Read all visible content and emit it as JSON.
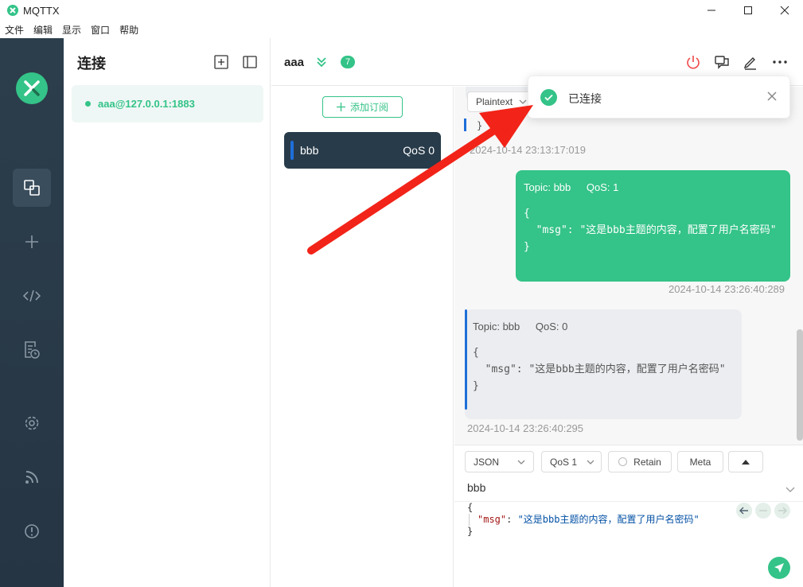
{
  "window": {
    "title": "MQTTX"
  },
  "menu": {
    "items": [
      "文件",
      "编辑",
      "显示",
      "窗口",
      "帮助"
    ]
  },
  "connections": {
    "title": "连接",
    "items": [
      {
        "name": "aaa@127.0.0.1:1883",
        "status": "connected"
      }
    ]
  },
  "header": {
    "name": "aaa",
    "unread_count": "7"
  },
  "subscriptions": {
    "add_label": "添加订阅",
    "items": [
      {
        "topic": "bbb",
        "qos": "QoS 0"
      }
    ]
  },
  "messages": {
    "format": "Plaintext",
    "prev_brace": "}",
    "prev_time": "2024-10-14 23:13:17:019",
    "list": [
      {
        "direction": "out",
        "topic": "Topic: bbb",
        "qos": "QoS: 1",
        "body": "{\n  \"msg\": \"这是bbb主题的内容，配置了用户名密码\"\n}",
        "time": "2024-10-14 23:26:40:289"
      },
      {
        "direction": "in",
        "topic": "Topic: bbb",
        "qos": "QoS: 0",
        "body": "{\n  \"msg\": \"这是bbb主题的内容，配置了用户名密码\"\n}",
        "time": "2024-10-14 23:26:40:295"
      }
    ]
  },
  "compose": {
    "format": "JSON",
    "qos": "QoS 1",
    "retain_label": "Retain",
    "meta_label": "Meta",
    "topic": "bbb",
    "body_open": "{",
    "body_key": "\"msg\"",
    "body_sep": ": ",
    "body_value": "\"这是bbb主题的内容，配置了用户名密码\"",
    "body_close": "}"
  },
  "toast": {
    "text": "已连接"
  },
  "colors": {
    "accent": "#34c388",
    "nav_bg": "#2c3e4c",
    "topic_bar": "#1e6fd9",
    "annotation_arrow": "#f22318"
  }
}
